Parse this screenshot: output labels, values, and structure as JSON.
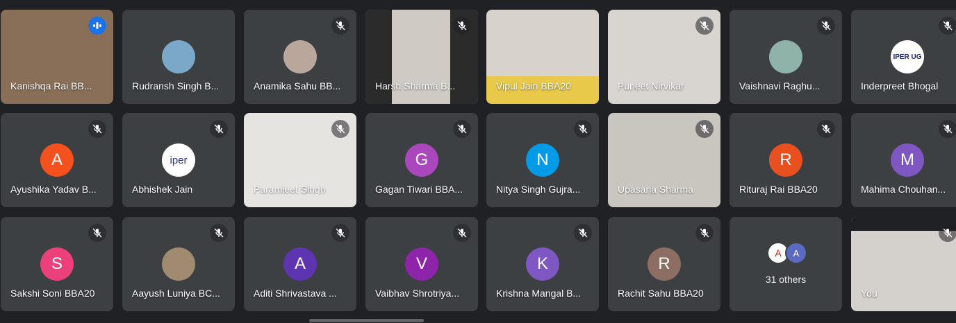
{
  "participants": [
    {
      "name": "Kanishqa Rai BB...",
      "speaking": true
    },
    {
      "name": "Rudransh Singh B...",
      "avatar": "profile-photo"
    },
    {
      "name": "Anamika Sahu BB...",
      "avatar": "profile-photo",
      "muted": true
    },
    {
      "name": "Harsh Sharma B...",
      "muted": true
    },
    {
      "name": "Vipul Jain BBA20"
    },
    {
      "name": "Puneet Nirvikar",
      "muted": true
    },
    {
      "name": "Vaishnavi Raghu...",
      "avatar": "profile-photo",
      "muted": true
    },
    {
      "name": "Inderpreet Bhogal",
      "avatar": "iper-ug-logo",
      "avatar_text": "IPER UG",
      "muted": true
    },
    {
      "name": "Ayushika Yadav B...",
      "initial": "A",
      "color": "#f4511e",
      "muted": true
    },
    {
      "name": "Abhishek Jain",
      "avatar": "iper-logo",
      "avatar_text": "iper",
      "muted": true
    },
    {
      "name": "Paramjeet Singh",
      "muted": true
    },
    {
      "name": "Gagan Tiwari BBA...",
      "initial": "G",
      "color": "#ab47bc",
      "muted": true
    },
    {
      "name": "Nitya Singh Gujra...",
      "initial": "N",
      "color": "#039be5",
      "muted": true
    },
    {
      "name": "Upasana Sharma",
      "muted": true
    },
    {
      "name": "Rituraj Rai BBA20",
      "initial": "R",
      "color": "#e8501f",
      "muted": true
    },
    {
      "name": "Mahima Chouhan...",
      "initial": "M",
      "color": "#7e57c2",
      "muted": true
    },
    {
      "name": "Sakshi Soni BBA20",
      "initial": "S",
      "color": "#ec407a",
      "muted": true
    },
    {
      "name": "Aayush Luniya BC...",
      "avatar": "profile-photo",
      "muted": true
    },
    {
      "name": "Aditi Shrivastava ...",
      "initial": "A",
      "color": "#5e35b1",
      "muted": true
    },
    {
      "name": "Vaibhav Shrotriya...",
      "initial": "V",
      "color": "#8e24aa",
      "muted": true
    },
    {
      "name": "Krishna Mangal B...",
      "initial": "K",
      "color": "#7e57c2",
      "muted": true
    },
    {
      "name": "Rachit Sahu BBA20",
      "initial": "R",
      "color": "#8d6e63",
      "muted": true
    },
    {
      "name": "",
      "others": true
    },
    {
      "name": "You",
      "muted": true
    }
  ],
  "others": {
    "label": "31 others",
    "avatar1": "A",
    "avatar2": "A"
  }
}
